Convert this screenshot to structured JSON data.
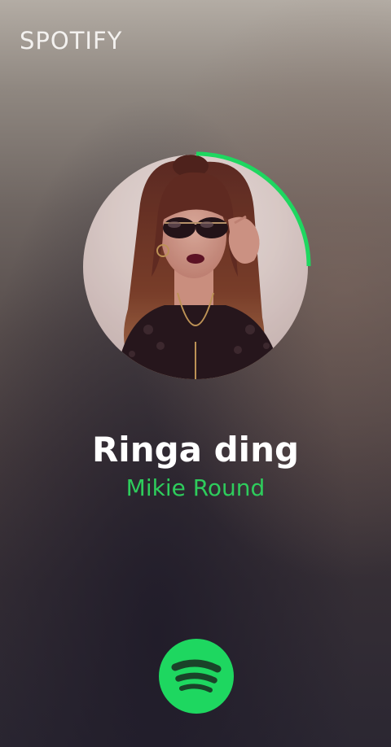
{
  "app": {
    "brand_label": "SPOTIFY"
  },
  "now_playing": {
    "track_title": "Ringa ding",
    "artist_name": "Mikie Round",
    "progress_fraction": 0.25,
    "album_art_icon": "album-art-portrait"
  },
  "actions": {
    "open_spotify_icon": "spotify-logo-icon"
  },
  "colors": {
    "accent": "#2ecc5c",
    "progress": "#1ed760",
    "title": "#ffffff",
    "spotify_button": "#1ed760"
  }
}
